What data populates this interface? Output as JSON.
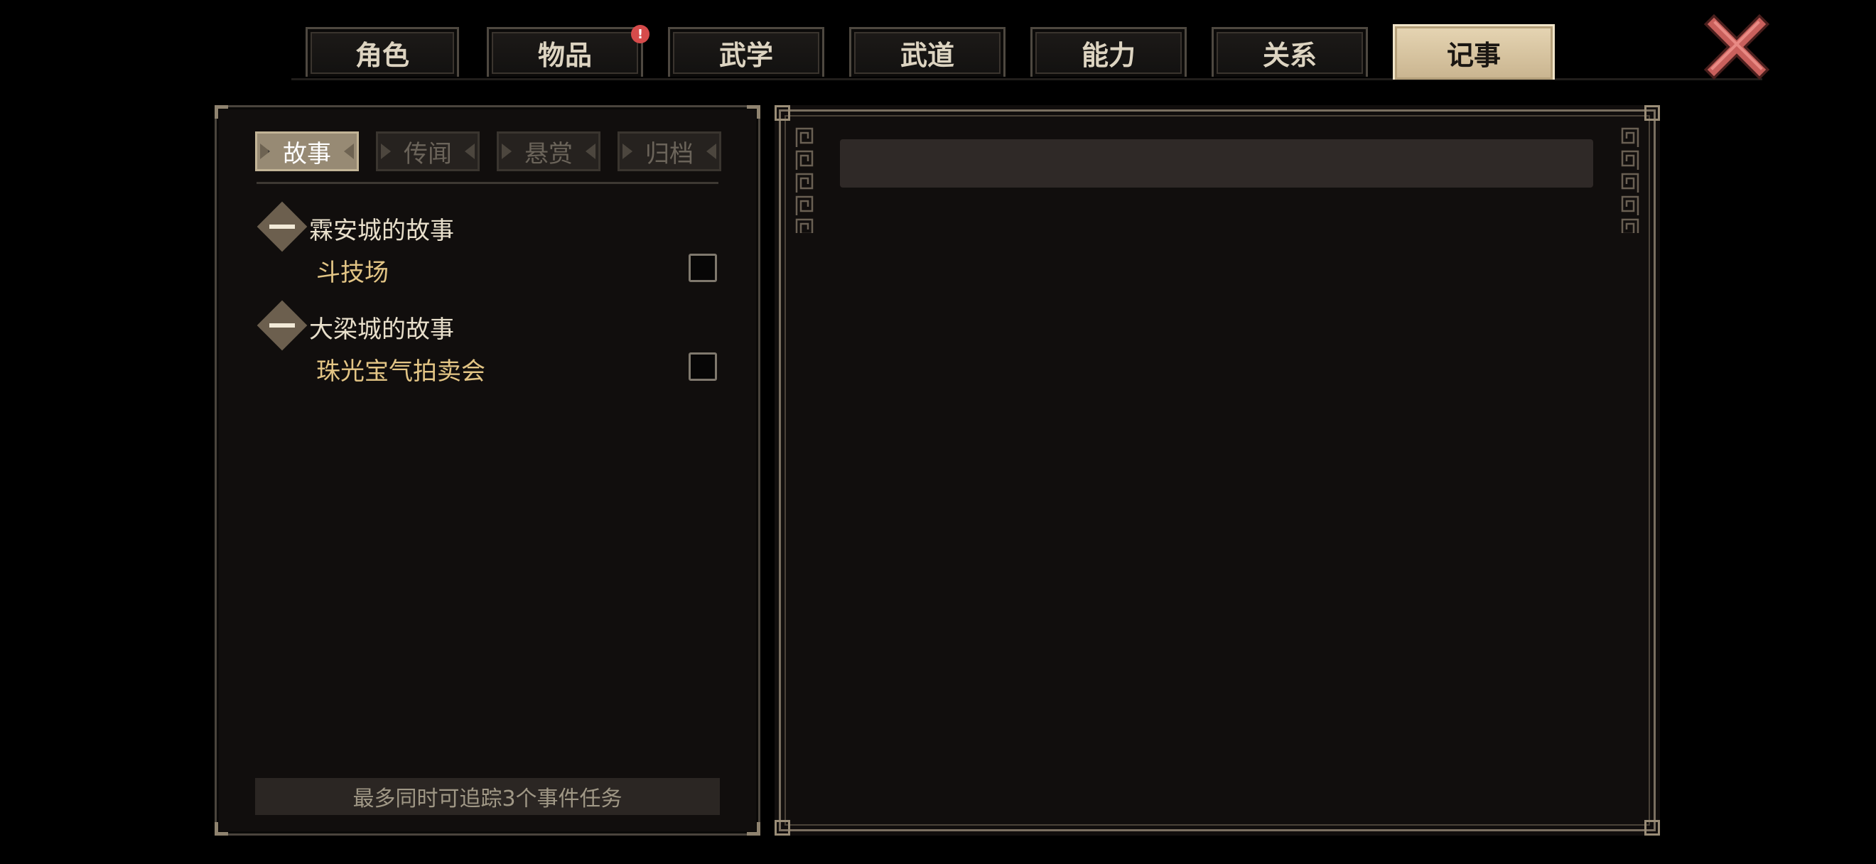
{
  "tabs": [
    {
      "label": "角色",
      "active": false
    },
    {
      "label": "物品",
      "active": false,
      "badge": "!"
    },
    {
      "label": "武学",
      "active": false
    },
    {
      "label": "武道",
      "active": false
    },
    {
      "label": "能力",
      "active": false
    },
    {
      "label": "关系",
      "active": false
    },
    {
      "label": "记事",
      "active": true
    }
  ],
  "close_icon": "close-x-icon",
  "journal": {
    "subtabs": [
      {
        "label": "故事",
        "active": true
      },
      {
        "label": "传闻",
        "active": false
      },
      {
        "label": "悬赏",
        "active": false
      },
      {
        "label": "归档",
        "active": false
      }
    ],
    "groups": [
      {
        "title": "霖安城的故事",
        "expanded": true,
        "items": [
          {
            "label": "斗技场",
            "tracked": false
          }
        ]
      },
      {
        "title": "大梁城的故事",
        "expanded": true,
        "items": [
          {
            "label": "珠光宝气拍卖会",
            "tracked": false
          }
        ]
      }
    ],
    "footer_note": "最多同时可追踪3个事件任务"
  },
  "detail": {
    "title": ""
  },
  "colors": {
    "active_tab": "#d9c7a3",
    "quest_item": "#e3c585",
    "close_icon": "#c9605c"
  }
}
